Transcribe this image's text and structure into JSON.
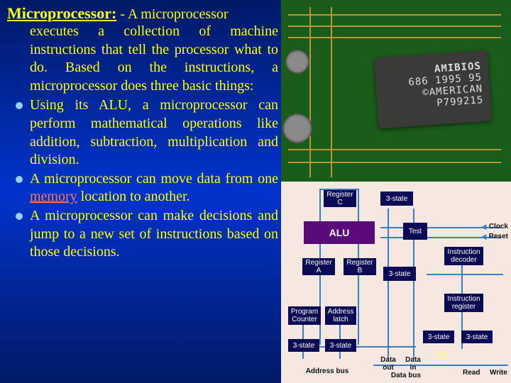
{
  "title": "Microprocessor:",
  "title_rest": " - A microprocessor",
  "intro": "executes a collection of machine instructions that tell the processor what to do. Based on the instructions, a microprocessor does three basic things:",
  "bullets": [
    {
      "text_a": "Using its ALU, a microprocessor can perform mathematical operations like addition, subtraction, multiplication and division."
    },
    {
      "text_a": "A microprocessor can move data from one ",
      "link": "memory",
      "text_b": " location to another."
    },
    {
      "text_a": "A microprocessor can make decisions and jump to a new set of instructions based on those decisions."
    }
  ],
  "chip": {
    "l1": "AMIBIOS",
    "l2": "686 1995 95",
    "l3": "©AMERICAN",
    "l4": "P799215"
  },
  "diagram": {
    "reg_c": "Register\nC",
    "tri1": "3-state",
    "alu": "ALU",
    "test": "Test",
    "clock": "Clock",
    "reset": "Reset",
    "dec": "Instruction\ndecoder",
    "reg_a": "Register\nA",
    "reg_b": "Register\nB",
    "tri2": "3-state",
    "pc": "Program\nCounter",
    "al": "Address\nlatch",
    "ir": "Instruction\nregister",
    "tri3": "3-state",
    "tri4": "3-state",
    "tri5": "3-state",
    "tri6": "3-state",
    "addr_bus": "Address bus",
    "dout": "Data\nout",
    "din": "Data\nin",
    "data_bus": "Data bus",
    "rd": "Read",
    "wr": "Write"
  },
  "page": "21"
}
